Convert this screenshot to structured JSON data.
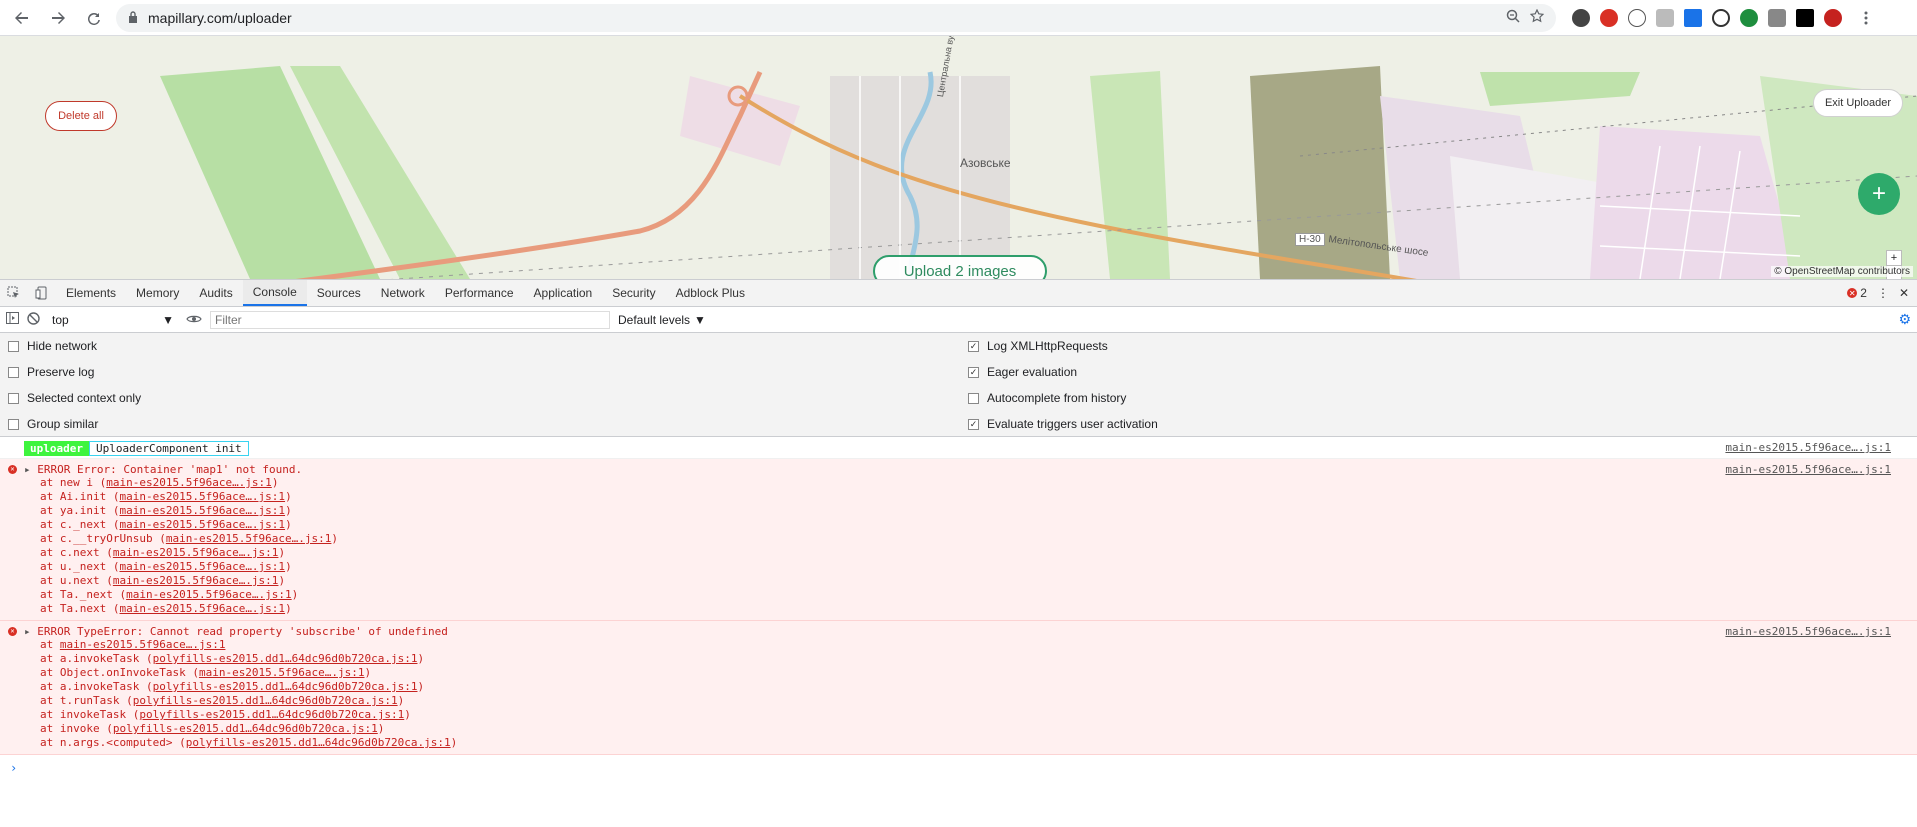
{
  "browser": {
    "url": "mapillary.com/uploader"
  },
  "map": {
    "delete_all": "Delete all",
    "exit_uploader": "Exit Uploader",
    "upload": "Upload 2 images",
    "fab": "+",
    "zoom_in": "+",
    "zoom_out": "-",
    "attribution": "© OpenStreetMap contributors",
    "place_name": "Азовське",
    "road_label": "Н-30",
    "street_label": "Мелітопольське шосе",
    "street_label_2": "Центральна вул."
  },
  "devtools": {
    "tabs": [
      "Elements",
      "Memory",
      "Audits",
      "Console",
      "Sources",
      "Network",
      "Performance",
      "Application",
      "Security",
      "Adblock Plus"
    ],
    "active_tab": "Console",
    "error_count": "2",
    "context": "top",
    "filter_placeholder": "Filter",
    "levels": "Default levels",
    "options_left": [
      {
        "label": "Hide network",
        "checked": false
      },
      {
        "label": "Preserve log",
        "checked": false
      },
      {
        "label": "Selected context only",
        "checked": false
      },
      {
        "label": "Group similar",
        "checked": false
      }
    ],
    "options_right": [
      {
        "label": "Log XMLHttpRequests",
        "checked": true
      },
      {
        "label": "Eager evaluation",
        "checked": true
      },
      {
        "label": "Autocomplete from history",
        "checked": false
      },
      {
        "label": "Evaluate triggers user activation",
        "checked": true
      }
    ]
  },
  "console": {
    "info": {
      "badge": "uploader",
      "message": "UploaderComponent init",
      "source": "main-es2015.5f96ace….js:1"
    },
    "errors": [
      {
        "head": "ERROR Error: Container 'map1' not found.",
        "source": "main-es2015.5f96ace….js:1",
        "stack": [
          {
            "pre": "at new i (",
            "link": "main-es2015.5f96ace….js:1",
            "post": ")"
          },
          {
            "pre": "at Ai.init (",
            "link": "main-es2015.5f96ace….js:1",
            "post": ")"
          },
          {
            "pre": "at ya.init (",
            "link": "main-es2015.5f96ace….js:1",
            "post": ")"
          },
          {
            "pre": "at c._next (",
            "link": "main-es2015.5f96ace….js:1",
            "post": ")"
          },
          {
            "pre": "at c.__tryOrUnsub (",
            "link": "main-es2015.5f96ace….js:1",
            "post": ")"
          },
          {
            "pre": "at c.next (",
            "link": "main-es2015.5f96ace….js:1",
            "post": ")"
          },
          {
            "pre": "at u._next (",
            "link": "main-es2015.5f96ace….js:1",
            "post": ")"
          },
          {
            "pre": "at u.next (",
            "link": "main-es2015.5f96ace….js:1",
            "post": ")"
          },
          {
            "pre": "at Ta._next (",
            "link": "main-es2015.5f96ace….js:1",
            "post": ")"
          },
          {
            "pre": "at Ta.next (",
            "link": "main-es2015.5f96ace….js:1",
            "post": ")"
          }
        ]
      },
      {
        "head": "ERROR TypeError: Cannot read property 'subscribe' of undefined",
        "source": "main-es2015.5f96ace….js:1",
        "stack": [
          {
            "pre": "at ",
            "link": "main-es2015.5f96ace….js:1",
            "post": ""
          },
          {
            "pre": "at a.invokeTask (",
            "link": "polyfills-es2015.dd1…64dc96d0b720ca.js:1",
            "post": ")"
          },
          {
            "pre": "at Object.onInvokeTask (",
            "link": "main-es2015.5f96ace….js:1",
            "post": ")"
          },
          {
            "pre": "at a.invokeTask (",
            "link": "polyfills-es2015.dd1…64dc96d0b720ca.js:1",
            "post": ")"
          },
          {
            "pre": "at t.runTask (",
            "link": "polyfills-es2015.dd1…64dc96d0b720ca.js:1",
            "post": ")"
          },
          {
            "pre": "at invokeTask (",
            "link": "polyfills-es2015.dd1…64dc96d0b720ca.js:1",
            "post": ")"
          },
          {
            "pre": "at invoke (",
            "link": "polyfills-es2015.dd1…64dc96d0b720ca.js:1",
            "post": ")"
          },
          {
            "pre": "at n.args.<computed> (",
            "link": "polyfills-es2015.dd1…64dc96d0b720ca.js:1",
            "post": ")"
          }
        ]
      }
    ],
    "prompt": "›"
  }
}
